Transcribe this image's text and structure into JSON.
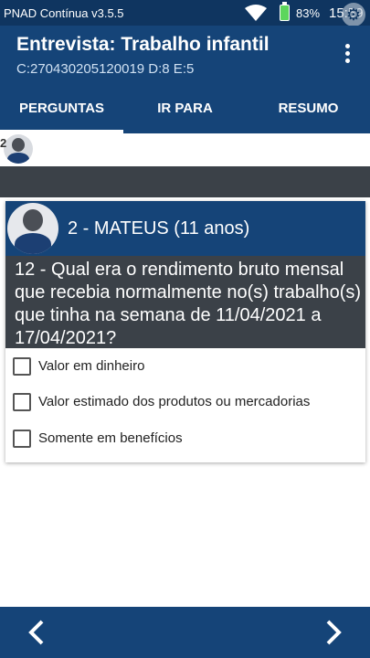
{
  "status_bar": {
    "app_name": "PNAD Contínua v3.5.5",
    "battery": "83%",
    "time": "15:59",
    "wifi_icon": "wifi-icon",
    "battery_icon": "battery-icon",
    "overlay_icon": "gear-icon"
  },
  "header": {
    "title": "Entrevista: Trabalho infantil",
    "subtitle": "C:270430205120019 D:8 E:5",
    "menu_icon": "more-vert-icon"
  },
  "tabs": [
    {
      "label": "PERGUNTAS",
      "active": true
    },
    {
      "label": "IR PARA",
      "active": false
    },
    {
      "label": "RESUMO",
      "active": false
    }
  ],
  "mini_person": {
    "number": "2"
  },
  "card": {
    "person_name": "2 - MATEUS (11 anos)",
    "question": "12 - Qual era o rendimento bruto mensal que recebia normalmente no(s) trabalho(s) que tinha na semana de 11/04/2021 a 17/04/2021?",
    "options": [
      {
        "label": "Valor em dinheiro",
        "checked": false
      },
      {
        "label": "Valor estimado dos produtos ou mercadorias",
        "checked": false
      },
      {
        "label": "Somente em benefícios",
        "checked": false
      }
    ]
  },
  "navigation": {
    "prev_icon": "chevron-left-icon",
    "next_icon": "chevron-right-icon"
  },
  "colors": {
    "primary": "#154478",
    "status_bar": "#0f3560",
    "question_bg": "#3b4148"
  }
}
